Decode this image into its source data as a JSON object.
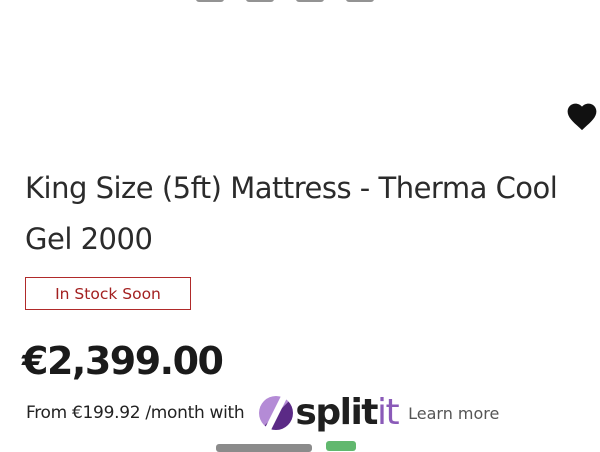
{
  "product": {
    "title": "King Size (5ft) Mattress - Therma Cool Gel 2000",
    "stock_status": "In Stock Soon",
    "price": "€2,399.00"
  },
  "financing": {
    "installment_text": "From €199.92 /month with",
    "provider_logo_part1": "split",
    "provider_logo_part2": "it",
    "learn_more_label": "Learn more"
  },
  "icons": {
    "wishlist": "heart-icon",
    "provider_mark": "splitit-logo-mark"
  },
  "colors": {
    "stock_badge": "#a32020",
    "logo_accent": "#8a5ab8",
    "logo_mark": "#5b2a86"
  }
}
